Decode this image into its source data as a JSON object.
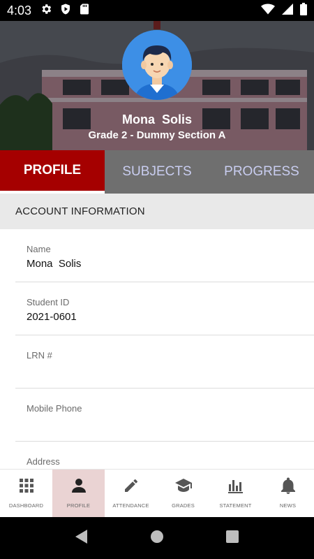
{
  "status_bar": {
    "time": "4:03",
    "icons_left": [
      "settings-icon",
      "play-protect-icon",
      "sd-card-icon"
    ],
    "icons_right": [
      "wifi-icon",
      "signal-icon",
      "battery-icon"
    ]
  },
  "profile_header": {
    "name": "Mona  Solis",
    "section": "Grade 2 - Dummy Section A"
  },
  "tabs": [
    {
      "label": "PROFILE",
      "active": true
    },
    {
      "label": "SUBJECTS",
      "active": false
    },
    {
      "label": "PROGRESS",
      "active": false
    }
  ],
  "account": {
    "title": "ACCOUNT INFORMATION",
    "fields": [
      {
        "label": "Name",
        "value": "Mona  Solis"
      },
      {
        "label": "Student ID",
        "value": "2021-0601"
      },
      {
        "label": "LRN #",
        "value": ""
      },
      {
        "label": "Mobile Phone",
        "value": ""
      },
      {
        "label": "Address",
        "value": ""
      }
    ]
  },
  "bottom_nav": [
    {
      "label": "DASHBOARD",
      "icon": "grid-icon",
      "active": false
    },
    {
      "label": "PROFILE",
      "icon": "person-icon",
      "active": true
    },
    {
      "label": "ATTENDANCE",
      "icon": "pencil-icon",
      "active": false
    },
    {
      "label": "GRADES",
      "icon": "graduation-cap-icon",
      "active": false
    },
    {
      "label": "STATEMENT",
      "icon": "bar-chart-icon",
      "active": false
    },
    {
      "label": "NEWS",
      "icon": "bell-icon",
      "active": false
    }
  ],
  "colors": {
    "accent": "#a50000",
    "tab_bar": "#6f6f6f",
    "inactive_tab_text": "#c9cdf0",
    "avatar_bg": "#3d8fe6",
    "active_nav_bg": "#ead3d3"
  }
}
